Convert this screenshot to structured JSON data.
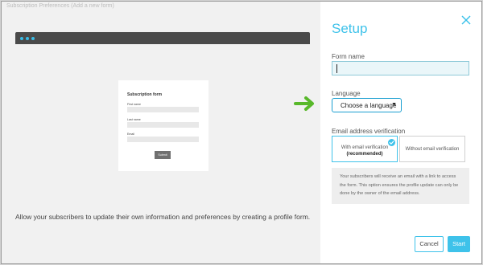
{
  "preview": {
    "faint_title": "Subscription Preferences (Add a new form)",
    "form_card": {
      "title": "Subscription form",
      "fields": [
        "First name",
        "Last name",
        "Email"
      ],
      "submit_label": "Submit"
    },
    "intro_text": "Allow your subscribers to update their own information and preferences by creating a profile form."
  },
  "panel": {
    "title": "Setup",
    "form_name": {
      "label": "Form name",
      "value": ""
    },
    "language": {
      "label": "Language",
      "selected": "Choose a language"
    },
    "verification": {
      "label": "Email address verification",
      "options": [
        {
          "line1": "With email verification",
          "line2": "(recommended)",
          "selected": true
        },
        {
          "line1": "Without email verification",
          "line2": "",
          "selected": false
        }
      ],
      "info": "Your subscribers will receive an email with a link to access the form. This option ensures the profile update can only be done by the owner of the email address."
    },
    "buttons": {
      "cancel": "Cancel",
      "start": "Start"
    }
  },
  "colors": {
    "accent": "#3ec2ea",
    "arrow": "#58b82a",
    "dark_bar": "#4a4a4a"
  },
  "icons": [
    "close-icon",
    "check-icon",
    "arrow-right-icon",
    "chevron-down-icon"
  ]
}
